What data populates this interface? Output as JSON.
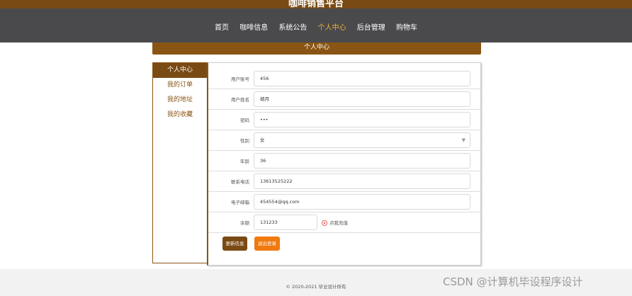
{
  "header": {
    "site_title": "咖啡销售平台"
  },
  "nav": {
    "items": [
      {
        "label": "首页"
      },
      {
        "label": "咖啡信息"
      },
      {
        "label": "系统公告"
      },
      {
        "label": "个人中心"
      },
      {
        "label": "后台管理"
      },
      {
        "label": "购物车"
      }
    ],
    "active": "个人中心"
  },
  "banner": {
    "title": "个人中心"
  },
  "sidebar": {
    "items": [
      {
        "label": "个人中心"
      },
      {
        "label": "我的订单"
      },
      {
        "label": "我的地址"
      },
      {
        "label": "我的收藏"
      }
    ]
  },
  "form": {
    "fields": [
      {
        "label": "用户账号",
        "value": "456"
      },
      {
        "label": "用户姓名",
        "value": "胡月"
      },
      {
        "label": "密码",
        "value": "•••"
      },
      {
        "label": "性别",
        "value": "女"
      },
      {
        "label": "年龄",
        "value": "36"
      },
      {
        "label": "联系电话",
        "value": "13613525222"
      },
      {
        "label": "电子邮箱",
        "value": "454554@qq.com"
      },
      {
        "label": "余额",
        "value": "131233"
      }
    ],
    "recharge_label": "点我充值",
    "update_button": "更新信息",
    "logout_button": "退出登录"
  },
  "footer": {
    "copyright": "© 2020-2021 毕业设计所有"
  },
  "watermark": "CSDN @计算机毕设程序设计",
  "colors": {
    "brand": "#7a4a14",
    "nav_bg": "#4a4a4d",
    "active_nav": "#f0b030",
    "logout": "#f07a10"
  }
}
